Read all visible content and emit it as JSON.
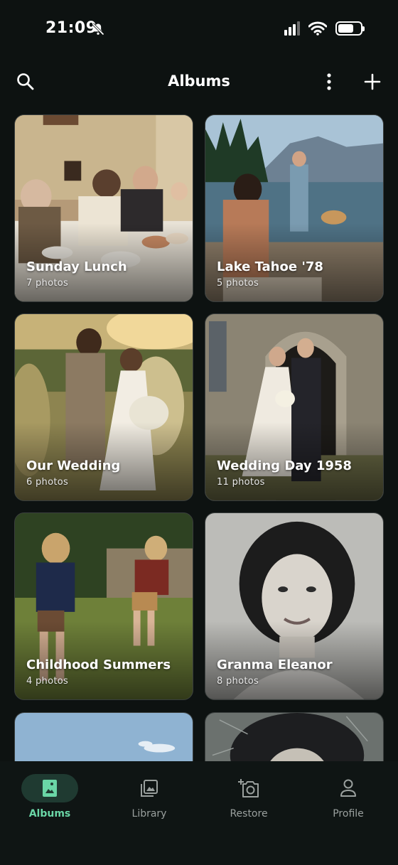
{
  "status_bar": {
    "time": "21:09"
  },
  "header": {
    "title": "Albums"
  },
  "albums": [
    {
      "title": "Sunday Lunch",
      "count": "7 photos"
    },
    {
      "title": "Lake Tahoe '78",
      "count": "5 photos"
    },
    {
      "title": "Our Wedding",
      "count": "6 photos"
    },
    {
      "title": "Wedding Day 1958",
      "count": "11 photos"
    },
    {
      "title": "Childhood Summers",
      "count": "4 photos"
    },
    {
      "title": "Granma Eleanor",
      "count": "8 photos"
    }
  ],
  "nav": {
    "items": [
      {
        "label": "Albums",
        "icon": "albums-icon",
        "active": true
      },
      {
        "label": "Library",
        "icon": "library-icon",
        "active": false
      },
      {
        "label": "Restore",
        "icon": "restore-camera-icon",
        "active": false
      },
      {
        "label": "Profile",
        "icon": "profile-icon",
        "active": false
      }
    ]
  },
  "colors": {
    "background": "#0d1211",
    "accent": "#6ad6a6",
    "active_pill": "#1f3a31"
  }
}
